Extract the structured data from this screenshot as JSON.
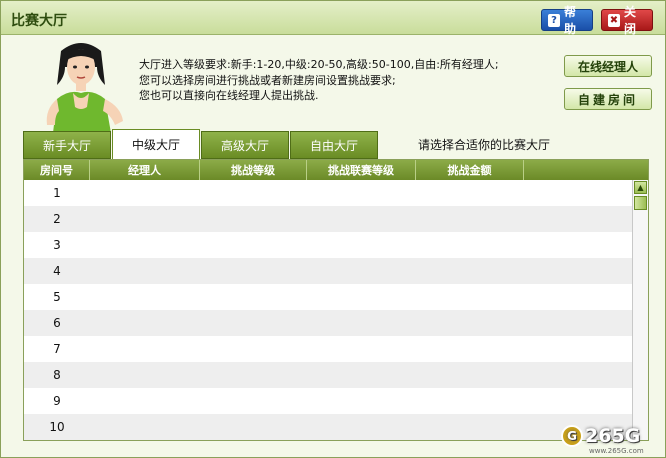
{
  "window": {
    "title": "比赛大厅",
    "help_label": "帮助",
    "close_label": "关闭"
  },
  "info": {
    "line1": "大厅进入等级要求:新手:1-20,中级:20-50,高级:50-100,自由:所有经理人;",
    "line2": "您可以选择房间进行挑战或者新建房间设置挑战要求;",
    "line3": "您也可以直接向在线经理人提出挑战."
  },
  "side_buttons": {
    "online_managers": "在线经理人",
    "create_room": "自建房间"
  },
  "tabs": [
    {
      "label": "新手大厅",
      "active": false
    },
    {
      "label": "中级大厅",
      "active": true
    },
    {
      "label": "高级大厅",
      "active": false
    },
    {
      "label": "自由大厅",
      "active": false
    }
  ],
  "hint": "请选择合适你的比赛大厅",
  "table": {
    "columns": [
      "房间号",
      "经理人",
      "挑战等级",
      "挑战联赛等级",
      "挑战金额"
    ],
    "rows": [
      "1",
      "2",
      "3",
      "4",
      "5",
      "6",
      "7",
      "8",
      "9",
      "10"
    ]
  },
  "watermark": {
    "brand": "265G",
    "url": "www.265G.com"
  },
  "colors": {
    "accent_green": "#6b8a27",
    "help_blue": "#1a4fa8",
    "close_red": "#a81818"
  }
}
